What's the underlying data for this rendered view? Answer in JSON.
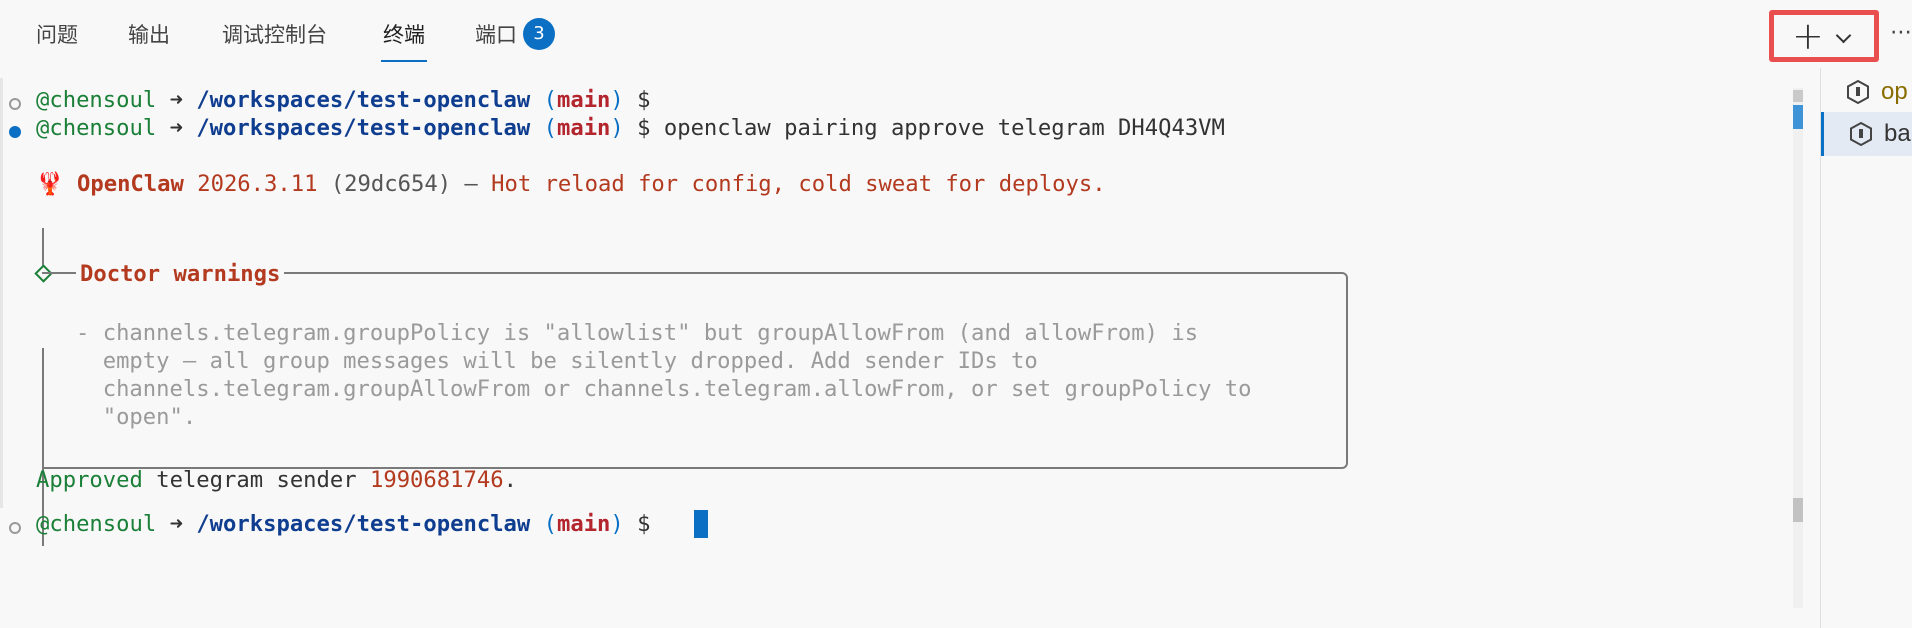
{
  "tabs": [
    {
      "label": "问题"
    },
    {
      "label": "输出"
    },
    {
      "label": "调试控制台"
    },
    {
      "label": "终端",
      "active": true
    },
    {
      "label": "端口",
      "badge": "3"
    }
  ],
  "toolbar": {
    "new_terminal_icon": "plus-icon",
    "dropdown_icon": "chevron-down-icon",
    "more_label": "⋯"
  },
  "terminal": {
    "prompt": {
      "user": "@chensoul",
      "arrow": "➜",
      "path": "/workspaces/test-openclaw",
      "paren_open": "(",
      "branch": "main",
      "paren_close": ")",
      "symbol": "$"
    },
    "command": "openclaw pairing approve telegram DH4Q43VM",
    "banner": {
      "emoji": "🦞",
      "name": "OpenClaw",
      "version": "2026.3.11",
      "hash": "(29dc654)",
      "dash": "—",
      "tagline": "Hot reload for config, cold sweat for deploys."
    },
    "warnings": {
      "title": "Doctor warnings",
      "lines": [
        "- channels.telegram.groupPolicy is \"allowlist\" but groupAllowFrom (and allowFrom) is",
        "  empty — all group messages will be silently dropped. Add sender IDs to",
        "  channels.telegram.groupAllowFrom or channels.telegram.allowFrom, or set groupPolicy to",
        "  \"open\"."
      ]
    },
    "result": {
      "approved": "Approved",
      "channel": "telegram",
      "sender_word": "sender",
      "sender_id": "1990681746",
      "period": "."
    }
  },
  "terminal_list": [
    {
      "label": "op",
      "icon": "terminal-icon"
    },
    {
      "label": "ba",
      "icon": "terminal-icon",
      "selected": true
    }
  ],
  "colors": {
    "accent": "#0b6fc4",
    "highlight_box": "#e94f4f",
    "user": "#1a7f37",
    "branch": "#b3262d",
    "warning": "#b3391f"
  }
}
